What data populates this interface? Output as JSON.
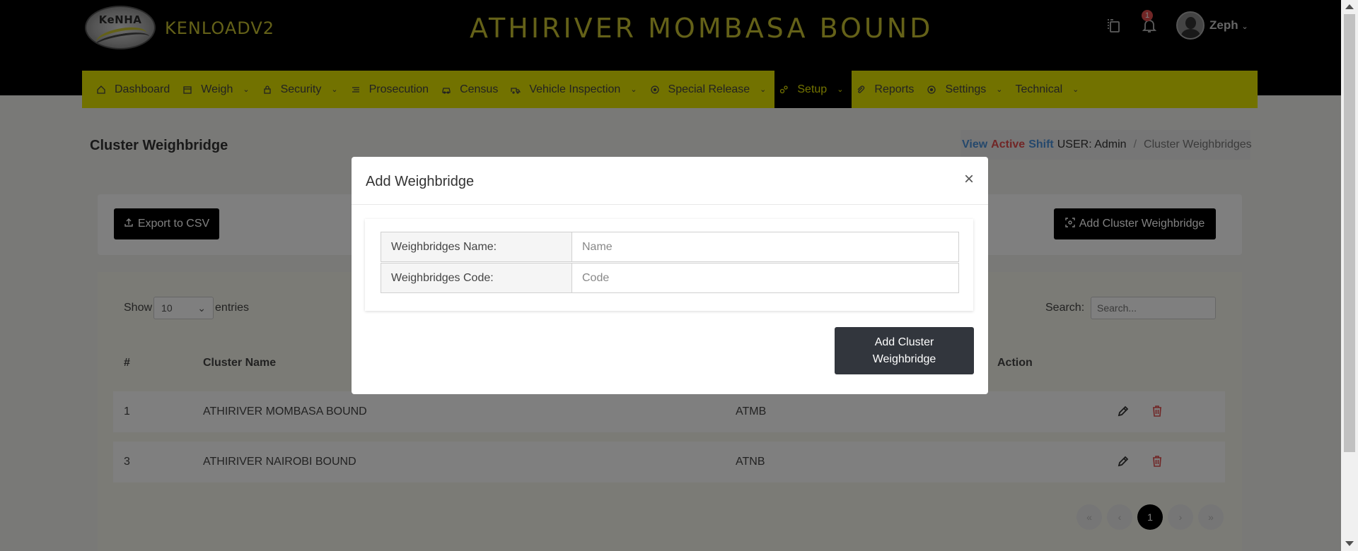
{
  "header": {
    "logo_text": "KeNHA",
    "brand": "KENLOADV2",
    "station": "ATHIRIVER MOMBASA BOUND",
    "notification_count": "1",
    "user_name": "Zeph",
    "icons": [
      "copy-icon",
      "bell-icon",
      "chevron-down-icon"
    ]
  },
  "nav": {
    "items": [
      {
        "label": "Dashboard",
        "icon": "home-icon",
        "dropdown": false
      },
      {
        "label": "Weigh",
        "icon": "calendar-icon",
        "dropdown": true
      },
      {
        "label": "Security",
        "icon": "lock-icon",
        "dropdown": true
      },
      {
        "label": "Prosecution",
        "icon": "list-icon",
        "dropdown": false
      },
      {
        "label": "Census",
        "icon": "car-icon",
        "dropdown": false
      },
      {
        "label": "Vehicle Inspection",
        "icon": "truck-icon",
        "dropdown": true
      },
      {
        "label": "Special Release",
        "icon": "target-icon",
        "dropdown": true
      },
      {
        "label": "Setup",
        "icon": "gears-icon",
        "dropdown": true,
        "active": true
      },
      {
        "label": "Reports",
        "icon": "paperclip-icon",
        "dropdown": false
      },
      {
        "label": "Settings",
        "icon": "target-icon",
        "dropdown": true
      },
      {
        "label": "Technical",
        "icon": "",
        "dropdown": true
      }
    ]
  },
  "page": {
    "title": "Cluster Weighbridge",
    "breadcrumb": {
      "view": "View",
      "active": "Active",
      "shift": "Shift",
      "user": "USER: Admin",
      "separator": "/",
      "current": "Cluster Weighbridges"
    },
    "export_label": "Export to CSV",
    "add_label": "Add Cluster Weighbridge"
  },
  "table": {
    "show_label": "Show",
    "entries_value": "10",
    "entries_label": "entries",
    "search_label": "Search:",
    "search_placeholder": "Search...",
    "headers": [
      "#",
      "Cluster Name",
      "Action"
    ],
    "rows": [
      {
        "num": "1",
        "name": "ATHIRIVER MOMBASA BOUND",
        "code": "ATMB"
      },
      {
        "num": "3",
        "name": "ATHIRIVER NAIROBI BOUND",
        "code": "ATNB"
      }
    ],
    "pagination": {
      "first": "«",
      "prev": "‹",
      "current": "1",
      "next": "›",
      "last": "»"
    }
  },
  "modal": {
    "title": "Add Weighbridge",
    "close": "×",
    "name_label": "Weighbridges Name:",
    "name_placeholder": "Name",
    "code_label": "Weighbridges Code:",
    "code_placeholder": "Code",
    "submit_label": "Add Cluster Weighbridge"
  },
  "colors": {
    "header_bg": "#000000",
    "accent_yellow": "#e5e500",
    "title_yellow": "#c9c330",
    "danger": "#e24c4c",
    "link_blue": "#4a90d9",
    "modal_button": "#32363d"
  }
}
